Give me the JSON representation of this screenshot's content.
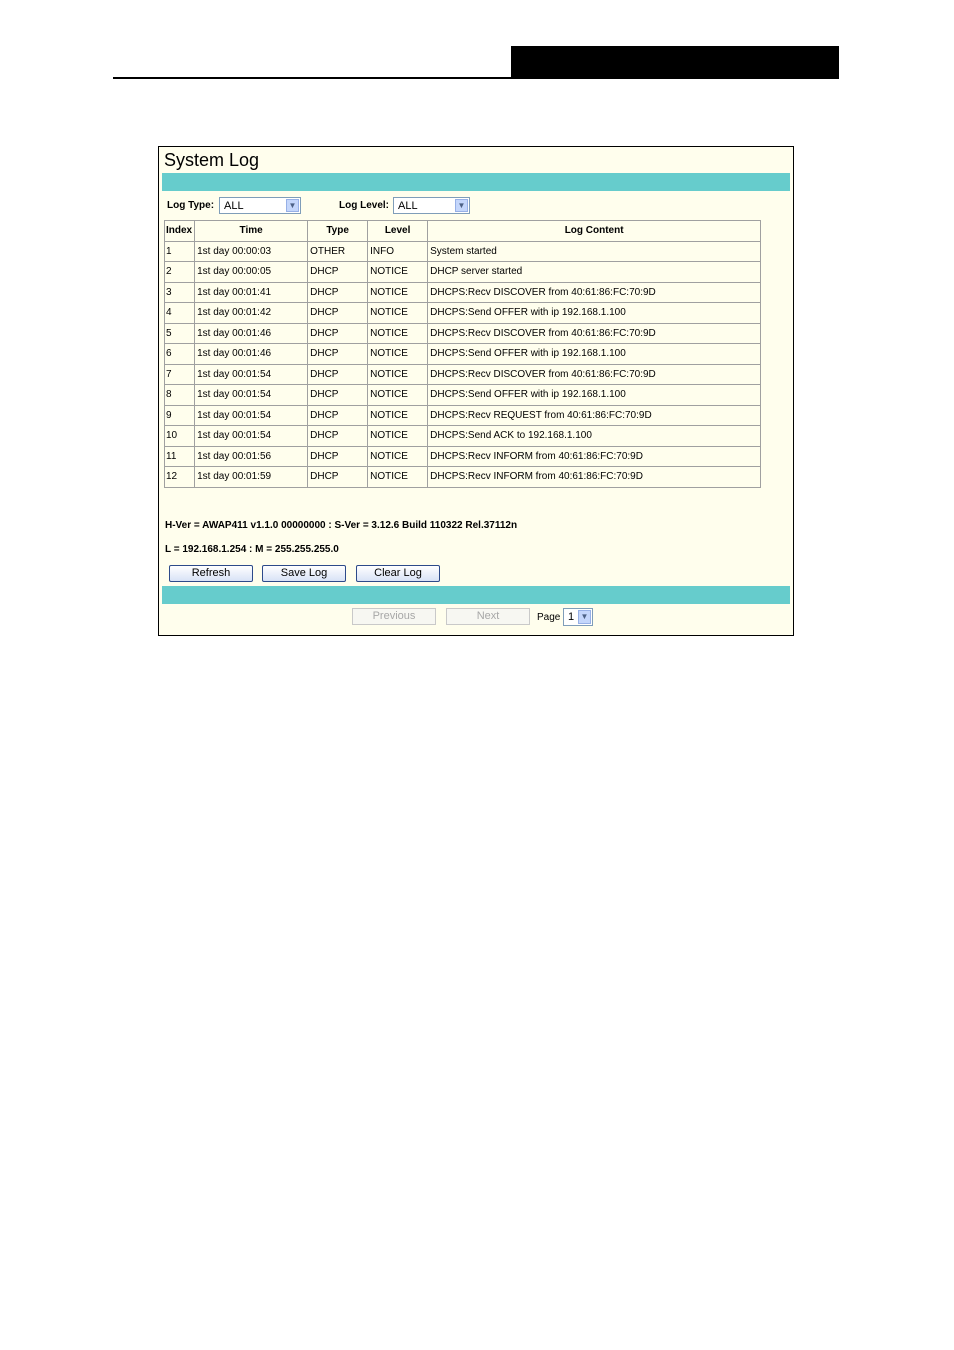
{
  "page": {
    "title": "System Log",
    "log_type_label": "Log Type:",
    "log_type_value": "ALL",
    "log_level_label": "Log Level:",
    "log_level_value": "ALL",
    "columns": [
      "Index",
      "Time",
      "Type",
      "Level",
      "Log Content"
    ],
    "rows": [
      [
        "1",
        "1st day 00:00:03",
        "OTHER",
        "INFO",
        "System started"
      ],
      [
        "2",
        "1st day 00:00:05",
        "DHCP",
        "NOTICE",
        "DHCP server started"
      ],
      [
        "3",
        "1st day 00:01:41",
        "DHCP",
        "NOTICE",
        "DHCPS:Recv DISCOVER from 40:61:86:FC:70:9D"
      ],
      [
        "4",
        "1st day 00:01:42",
        "DHCP",
        "NOTICE",
        "DHCPS:Send OFFER with ip 192.168.1.100"
      ],
      [
        "5",
        "1st day 00:01:46",
        "DHCP",
        "NOTICE",
        "DHCPS:Recv DISCOVER from 40:61:86:FC:70:9D"
      ],
      [
        "6",
        "1st day 00:01:46",
        "DHCP",
        "NOTICE",
        "DHCPS:Send OFFER with ip 192.168.1.100"
      ],
      [
        "7",
        "1st day 00:01:54",
        "DHCP",
        "NOTICE",
        "DHCPS:Recv DISCOVER from 40:61:86:FC:70:9D"
      ],
      [
        "8",
        "1st day 00:01:54",
        "DHCP",
        "NOTICE",
        "DHCPS:Send OFFER with ip 192.168.1.100"
      ],
      [
        "9",
        "1st day 00:01:54",
        "DHCP",
        "NOTICE",
        "DHCPS:Recv REQUEST from 40:61:86:FC:70:9D"
      ],
      [
        "10",
        "1st day 00:01:54",
        "DHCP",
        "NOTICE",
        "DHCPS:Send ACK to 192.168.1.100"
      ],
      [
        "11",
        "1st day 00:01:56",
        "DHCP",
        "NOTICE",
        "DHCPS:Recv INFORM from 40:61:86:FC:70:9D"
      ],
      [
        "12",
        "1st day 00:01:59",
        "DHCP",
        "NOTICE",
        "DHCPS:Recv INFORM from 40:61:86:FC:70:9D"
      ]
    ],
    "version_line": "H-Ver = AWAP411 v1.1.0 00000000 : S-Ver = 3.12.6 Build 110322 Rel.37112n",
    "ip_line": "L = 192.168.1.254 : M = 255.255.255.0",
    "buttons": {
      "refresh": "Refresh",
      "save": "Save Log",
      "clear": "Clear Log"
    },
    "pager": {
      "previous": "Previous",
      "next": "Next",
      "page_label": "Page",
      "page_value": "1"
    },
    "colors": {
      "band": "#66cccc",
      "panel_bg": "#fffeed"
    }
  }
}
